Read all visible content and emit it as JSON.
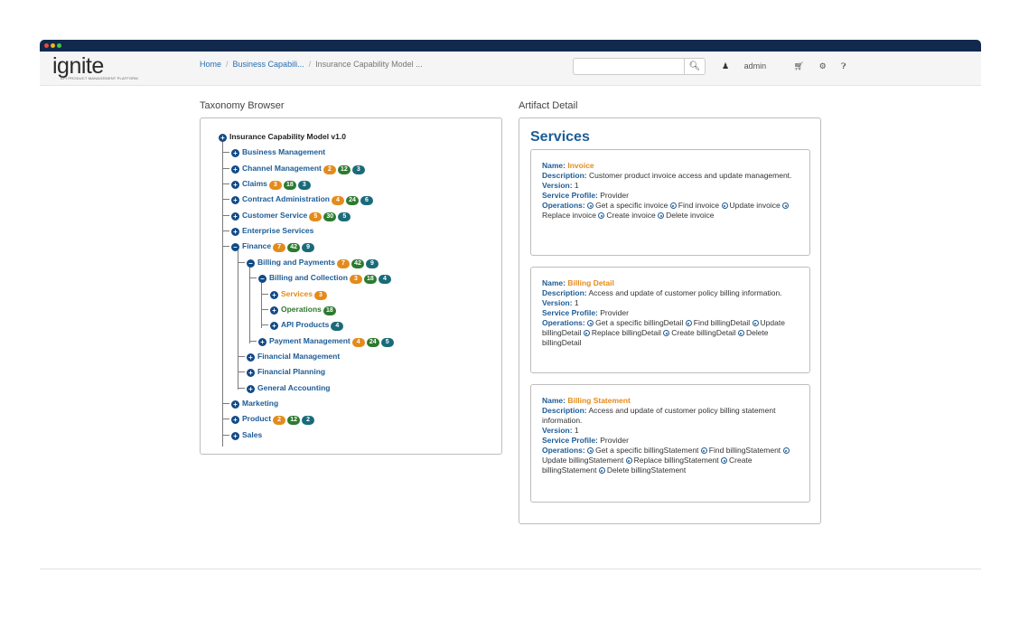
{
  "app": {
    "logo": "ignite",
    "logo_sub": "API PRODUCT MANAGEMENT PLATFORM"
  },
  "breadcrumb": {
    "items": [
      "Home",
      "Business Capabili...",
      "Insurance Capability Model ..."
    ]
  },
  "header": {
    "search_placeholder": "",
    "search_icon": "search-icon",
    "user": "admin",
    "icons": [
      "user-icon",
      "cart-icon",
      "gear-icon",
      "help-icon"
    ]
  },
  "taxonomy": {
    "title": "Taxonomy Browser",
    "nodes": [
      {
        "label": "Insurance Capability Model v1.0"
      },
      {
        "label": "Business Management"
      },
      {
        "label": "Channel Management",
        "badges": [
          "2",
          "12",
          "3"
        ]
      },
      {
        "label": "Claims",
        "badges": [
          "3",
          "18",
          "3"
        ]
      },
      {
        "label": "Contract Administration",
        "badges": [
          "4",
          "24",
          "6"
        ]
      },
      {
        "label": "Customer Service",
        "badges": [
          "5",
          "30",
          "5"
        ]
      },
      {
        "label": "Enterprise Services"
      },
      {
        "label": "Finance",
        "badges": [
          "7",
          "42",
          "9"
        ]
      },
      {
        "label": "Billing and Payments",
        "badges": [
          "7",
          "42",
          "9"
        ]
      },
      {
        "label": "Billing and Collection",
        "badges": [
          "3",
          "18",
          "4"
        ]
      },
      {
        "label": "Services",
        "badges": [
          "3"
        ]
      },
      {
        "label": "Operations",
        "badges": [
          "18"
        ]
      },
      {
        "label": "API Products",
        "badges": [
          "4"
        ]
      },
      {
        "label": "Payment Management",
        "badges": [
          "4",
          "24",
          "5"
        ]
      },
      {
        "label": "Financial Management"
      },
      {
        "label": "Financial Planning"
      },
      {
        "label": "General Accounting"
      },
      {
        "label": "Marketing"
      },
      {
        "label": "Product",
        "badges": [
          "2",
          "12",
          "2"
        ]
      },
      {
        "label": "Sales"
      }
    ]
  },
  "detail": {
    "title": "Artifact Detail",
    "heading": "Services",
    "labels": {
      "name": "Name:",
      "description": "Description:",
      "version": "Version:",
      "profile": "Service Profile:",
      "operations": "Operations:"
    },
    "cards": [
      {
        "name": "Invoice",
        "description": "Customer product invoice access and update management.",
        "version": "1",
        "profile": "Provider",
        "operations": [
          "Get a specific invoice",
          "Find invoice",
          "Update invoice",
          "Replace invoice",
          "Create invoice",
          "Delete invoice"
        ]
      },
      {
        "name": "Billing Detail",
        "description": "Access and update of customer policy billing information.",
        "version": "1",
        "profile": "Provider",
        "operations": [
          "Get a specific billingDetail",
          "Find billingDetail",
          "Update billingDetail",
          "Replace billingDetail",
          "Create billingDetail",
          "Delete billingDetail"
        ]
      },
      {
        "name": "Billing Statement",
        "description": "Access and update of customer policy billing statement information.",
        "version": "1",
        "profile": "Provider",
        "operations": [
          "Get a specific billingStatement",
          "Find billingStatement",
          "Update billingStatement",
          "Replace billingStatement",
          "Create billingStatement",
          "Delete billingStatement"
        ]
      }
    ]
  }
}
